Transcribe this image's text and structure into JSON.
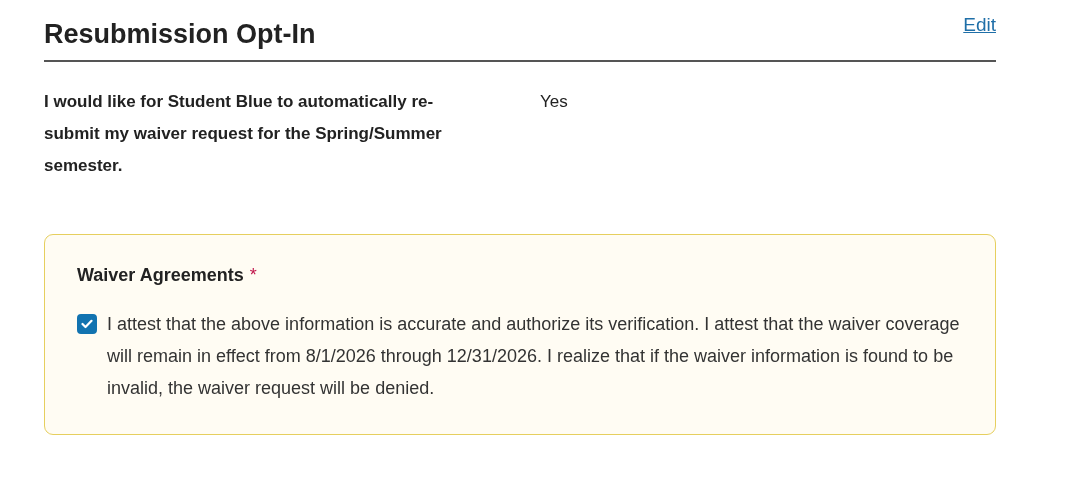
{
  "section": {
    "title": "Resubmission Opt-In",
    "edit_link": "Edit"
  },
  "question": {
    "label": "I would like for Student Blue to automatically re-submit my waiver request for the Spring/Summer semester.",
    "answer": "Yes"
  },
  "agreements": {
    "heading": "Waiver Agreements",
    "required_mark": "*",
    "items": [
      {
        "text": "I attest that the above information is accurate and authorize its verification. I attest that the waiver coverage will remain in effect from 8/1/2026 through 12/31/2026. I realize that if the waiver information is found to be invalid, the waiver request will be denied.",
        "checked": true
      }
    ]
  }
}
